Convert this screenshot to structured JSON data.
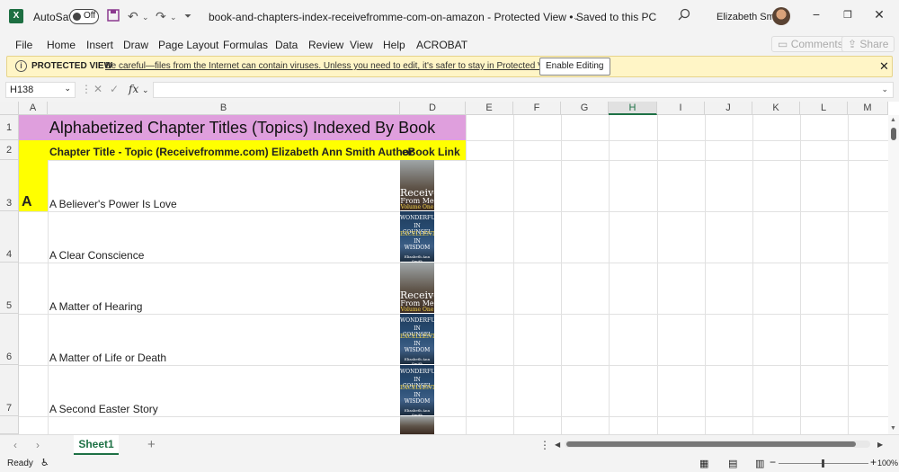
{
  "titlebar": {
    "app_icon": "X",
    "autosave_label": "AutoSave",
    "autosave_state": "Off",
    "document_title": "book-and-chapters-index-receivefromme-com-on-amazon  -  Protected View • Saved to this PC",
    "user_name": "Elizabeth Smith"
  },
  "menu": {
    "items": [
      "File",
      "Home",
      "Insert",
      "Draw",
      "Page Layout",
      "Formulas",
      "Data",
      "Review",
      "View",
      "Help",
      "ACROBAT"
    ],
    "comments": "Comments",
    "share": "Share"
  },
  "message_bar": {
    "title": "PROTECTED VIEW",
    "message": "Be careful—files from the Internet can contain viruses. Unless you need to edit, it's safer to stay in Protected View.",
    "button": "Enable Editing"
  },
  "formula_bar": {
    "name_box": "H138",
    "fx": "fx",
    "formula": ""
  },
  "grid": {
    "columns": [
      "A",
      "B",
      "D",
      "E",
      "F",
      "G",
      "H",
      "I",
      "J",
      "K",
      "L",
      "M"
    ],
    "selected_column": "H",
    "rows": [
      "1",
      "2",
      "3",
      "4",
      "5",
      "6",
      "7"
    ],
    "title": "Alphabetized Chapter Titles (Topics) Indexed By Book",
    "header_chapter": "Chapter Title - Topic   (Receivefromme.com)  Elizabeth Ann Smith Author",
    "header_link": "eBook Link",
    "section_letter": "A",
    "chapters": [
      "A Believer's Power Is Love",
      "A Clear Conscience",
      "A Matter of Hearing",
      "A Matter of Life or Death",
      "A Second Easter Story"
    ],
    "book_a": {
      "line1": "Receive",
      "line2": "From Me",
      "line3": "Volume One"
    },
    "book_b": {
      "line1": "WONDERFUL",
      "line2": "IN COUNSEL",
      "line3": "EXCELLENT",
      "line4": "IN WISDOM",
      "author": "Elizabeth Ann Smith"
    }
  },
  "sheets": {
    "active": "Sheet1"
  },
  "status": {
    "ready": "Ready",
    "zoom": "100%"
  },
  "colors": {
    "title_fill": "#df9fdd",
    "header_fill": "#ffff00",
    "excel_green": "#1e7145"
  }
}
